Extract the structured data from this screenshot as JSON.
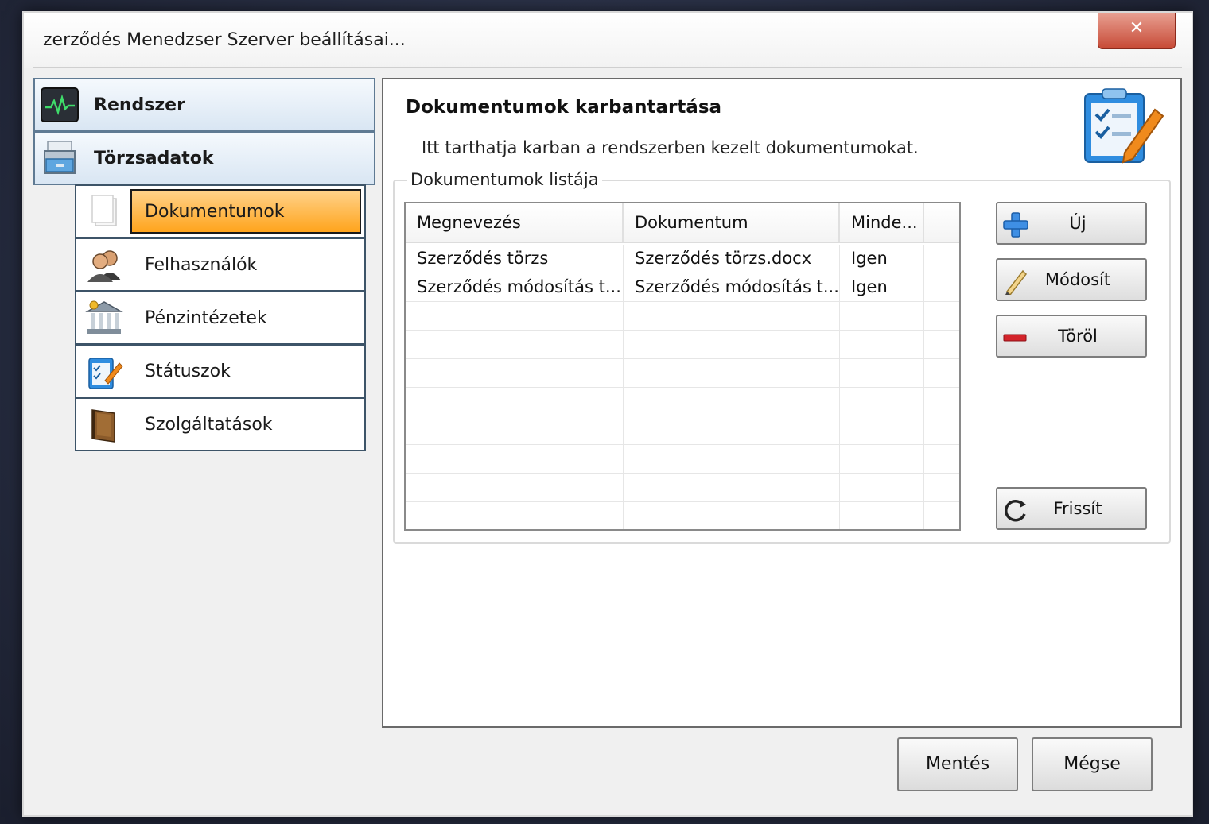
{
  "window": {
    "title": "zerződés Menedzser Szerver beállításai..."
  },
  "nav": {
    "groups": [
      {
        "label": "Rendszer",
        "icon": "system-monitor-icon"
      },
      {
        "label": "Törzsadatok",
        "icon": "database-drawer-icon"
      }
    ],
    "items": [
      {
        "label": "Dokumentumok",
        "icon": "documents-icon",
        "selected": true
      },
      {
        "label": "Felhasználók",
        "icon": "users-icon",
        "selected": false
      },
      {
        "label": "Pénzintézetek",
        "icon": "bank-icon",
        "selected": false
      },
      {
        "label": "Státuszok",
        "icon": "checklist-icon",
        "selected": false
      },
      {
        "label": "Szolgáltatások",
        "icon": "book-icon",
        "selected": false
      }
    ]
  },
  "panel": {
    "title": "Dokumentumok karbantartása",
    "description": "Itt tarthatja karban a rendszerben kezelt dokumentumokat.",
    "icon": "clipboard-checklist-icon",
    "group_title": "Dokumentumok listája",
    "grid": {
      "columns": [
        "Megnevezés",
        "Dokumentum",
        "Minde..."
      ],
      "rows": [
        [
          "Szerződés törzs",
          "Szerződés törzs.docx",
          "Igen"
        ],
        [
          "Szerződés módosítás t...",
          "Szerződés módosítás t...",
          "Igen"
        ]
      ]
    },
    "buttons": {
      "new": {
        "label": "Új",
        "icon": "plus-icon"
      },
      "edit": {
        "label": "Módosít",
        "icon": "pencil-icon"
      },
      "delete": {
        "label": "Töröl",
        "icon": "minus-icon"
      },
      "refresh": {
        "label": "Frissít",
        "icon": "refresh-icon"
      }
    }
  },
  "footer": {
    "save_label": "Mentés",
    "cancel_label": "Mégse"
  },
  "colors": {
    "selection": "#ffa41c",
    "nav_header": "#d9e6f3",
    "close_button": "#c74a36"
  }
}
